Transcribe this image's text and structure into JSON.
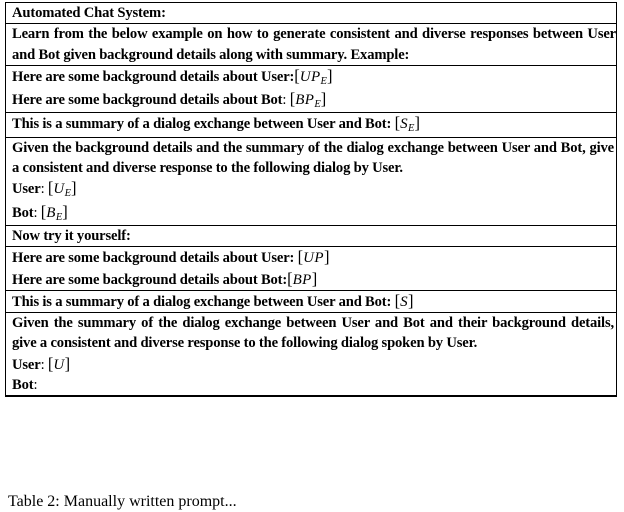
{
  "document": {
    "caption": "Table 2:  Manually written prompt..."
  },
  "table": {
    "rows": [
      {
        "id": "header",
        "text": "Automated Chat System:"
      },
      {
        "id": "instruction-example",
        "text": "Learn from the below example on how to generate consistent and diverse responses between User and Bot given background details along with summary. Example:"
      },
      {
        "id": "example-user-background",
        "label": "Here are some background details about User:",
        "value": "[UP_E]",
        "var_main": "UP",
        "var_sub": "E"
      },
      {
        "id": "example-bot-background",
        "label": "Here are some background details about Bot",
        "label_colon": ":",
        "value": "[BP_E]",
        "var_main": "BP",
        "var_sub": "E"
      },
      {
        "id": "example-summary",
        "label": "This is a summary of a dialog exchange between User and Bot:",
        "value": "[S_E]",
        "var_main": "S",
        "var_sub": "E"
      },
      {
        "id": "example-instruction",
        "text": "Given the background details and the summary of the dialog exchange between User and Bot, give a consistent and diverse response to the following dialog by User."
      },
      {
        "id": "example-user-turn",
        "label": "User",
        "label_colon": ":",
        "value": "[U_E]",
        "var_main": "U",
        "var_sub": "E"
      },
      {
        "id": "example-bot-turn",
        "label": "Bot",
        "label_colon": ":",
        "value": "[B_E]",
        "var_main": "B",
        "var_sub": "E"
      },
      {
        "id": "now-try",
        "text": "Now try it yourself:"
      },
      {
        "id": "task-user-background",
        "label": "Here are some background details about User:",
        "value": "[UP]",
        "var_main": "UP",
        "var_sub": ""
      },
      {
        "id": "task-bot-background",
        "label": "Here are some background details about Bot:",
        "value": "[BP]",
        "var_main": "BP",
        "var_sub": ""
      },
      {
        "id": "task-summary",
        "label": "This is a summary of a dialog exchange between User and Bot:",
        "value": "[S]",
        "var_main": "S",
        "var_sub": ""
      },
      {
        "id": "task-instruction",
        "text": "Given the summary of the dialog exchange between User and Bot and their background details, give a consistent and diverse response to the following dialog spoken by User."
      },
      {
        "id": "task-user-turn",
        "label": "User",
        "label_colon": ":",
        "value": "[U]",
        "var_main": "U",
        "var_sub": ""
      },
      {
        "id": "task-bot-turn",
        "label": "Bot",
        "label_colon": ":",
        "value": "",
        "var_main": "",
        "var_sub": ""
      }
    ]
  },
  "math_brackets": {
    "open": "[",
    "close": "]"
  }
}
